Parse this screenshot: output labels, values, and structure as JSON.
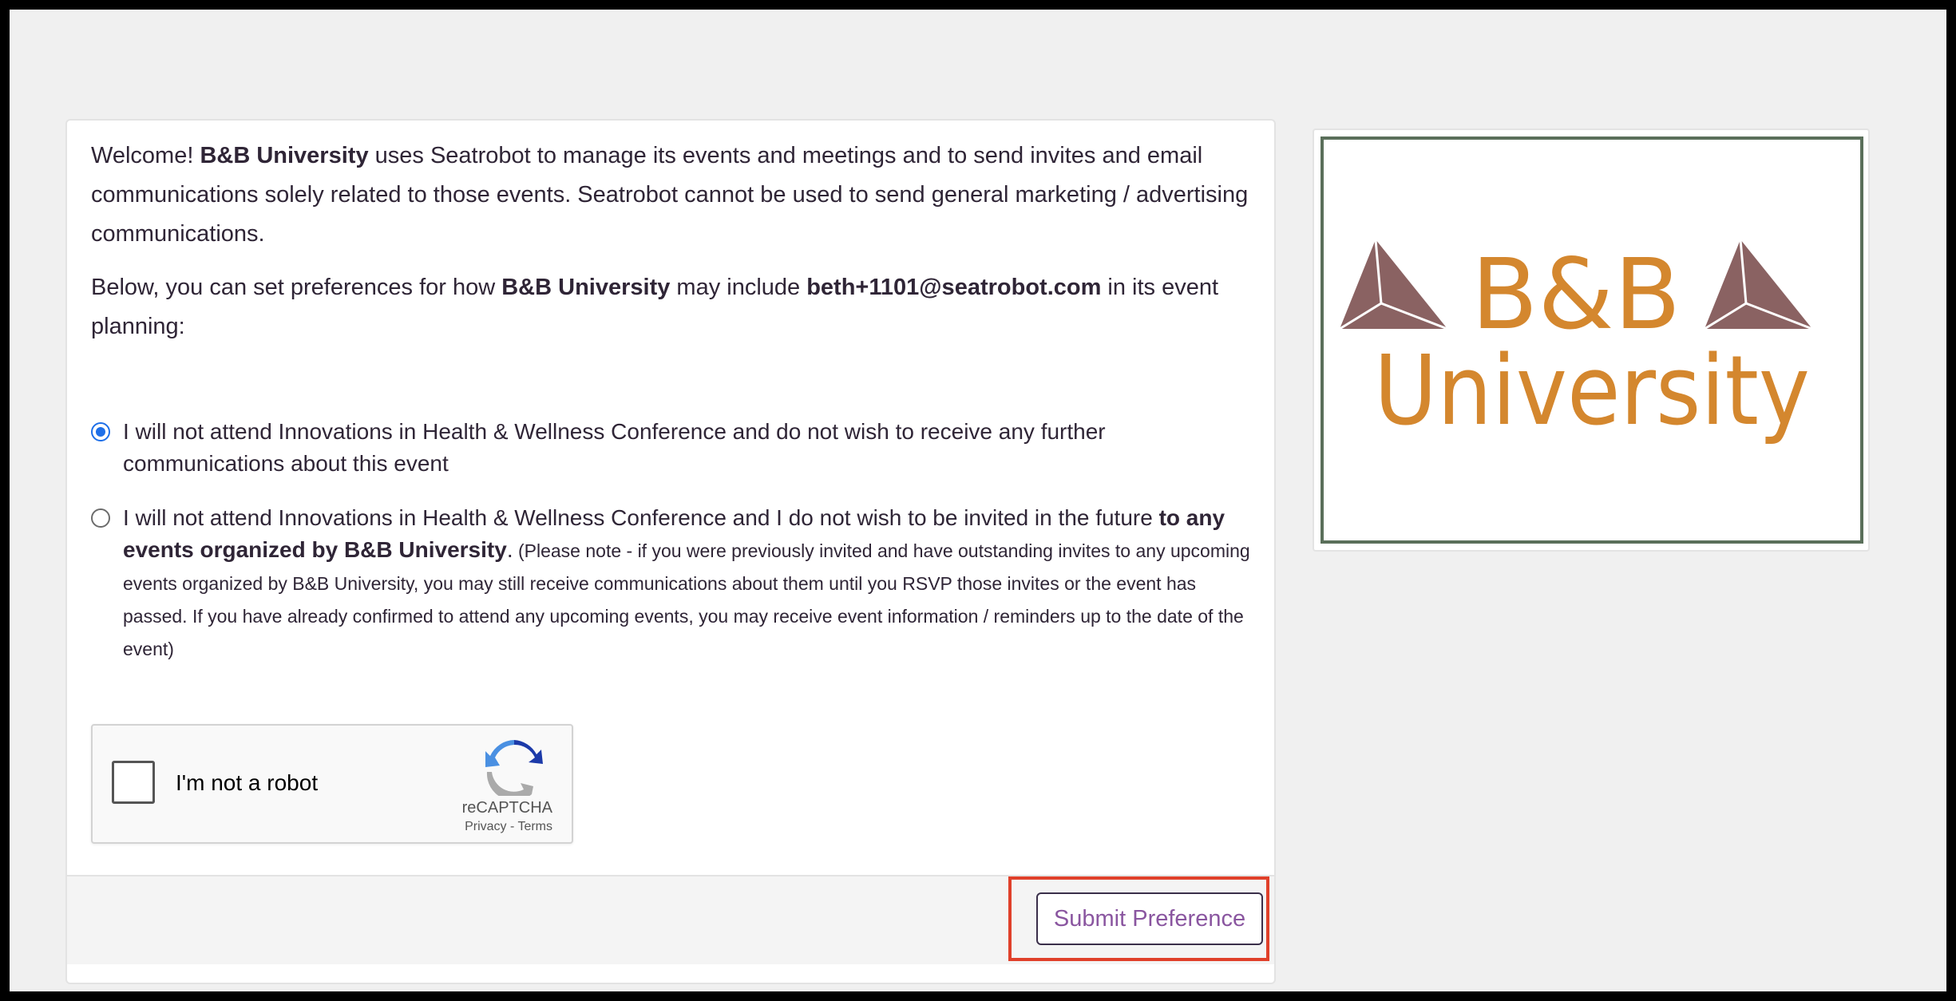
{
  "intro": {
    "welcome": "Welcome! ",
    "org_name": "B&B University",
    "rest": " uses Seatrobot to manage its events and meetings and to send invites and email communications solely related to those events. Seatrobot cannot be used to send general marketing / advertising communications."
  },
  "prefs_intro": {
    "lead": "Below, you can set preferences for how ",
    "org_name": "B&B University",
    "mid": " may include ",
    "email": "beth+1101@seatrobot.com",
    "tail": " in its event planning:"
  },
  "options": [
    {
      "text": "I will not attend Innovations in Health & Wellness Conference and do not wish to receive any further communications about this event",
      "checked": true
    },
    {
      "text": "I will not attend Innovations in Health & Wellness Conference and I do not wish to be invited in the future ",
      "bold": "to any events organized by B&B University",
      "period": ".",
      "note": " (Please note - if you were previously invited and have outstanding invites to any upcoming events organized by B&B University, you may still receive communications about them until you RSVP those invites or the event has passed. If you have already confirmed to attend any upcoming events, you may receive event information / reminders up to the date of the event)",
      "checked": false
    }
  ],
  "captcha": {
    "label": "I'm not a robot",
    "brand": "reCAPTCHA",
    "links": "Privacy - Terms"
  },
  "submit": {
    "label": "Submit Preference"
  },
  "logo": {
    "line1": "B&B",
    "line2": "University",
    "text_color": "#d4872e",
    "triangle_color": "#8a6262",
    "border_color": "#5a6f5a"
  }
}
